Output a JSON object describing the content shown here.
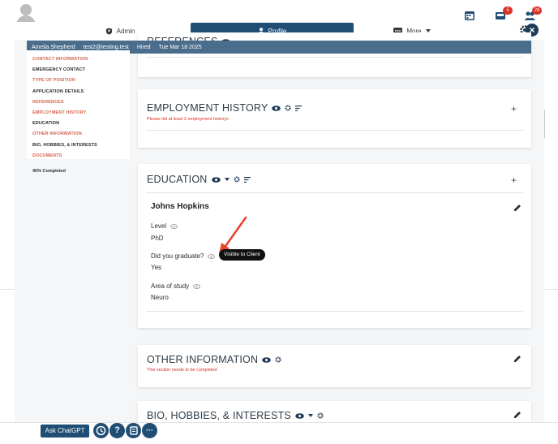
{
  "topbar": {
    "badges": {
      "inbox": "5",
      "users": "28"
    }
  },
  "tabs": {
    "admin": "Admin",
    "profile": "Profile",
    "more": "More"
  },
  "infobar": {
    "name": "Amelia Shepherd",
    "email": "test2@testing.test",
    "status": "Hired",
    "date": "Tue Mar 18 2025"
  },
  "sidebar": {
    "items": [
      {
        "label": "CONTACT INFORMATION",
        "state": "incomplete"
      },
      {
        "label": "EMERGENCY CONTACT",
        "state": "complete"
      },
      {
        "label": "TYPE OF POSITION",
        "state": "incomplete"
      },
      {
        "label": "APPLICATION DETAILS",
        "state": "complete"
      },
      {
        "label": "REFERENCES",
        "state": "incomplete"
      },
      {
        "label": "EMPLOYMENT HISTORY",
        "state": "incomplete"
      },
      {
        "label": "EDUCATION",
        "state": "complete"
      },
      {
        "label": "OTHER INFORMATION",
        "state": "incomplete"
      },
      {
        "label": "BIO, HOBBIES, & INTERESTS",
        "state": "complete"
      },
      {
        "label": "DOCUMENTS",
        "state": "incomplete"
      }
    ],
    "progress": "40% Completed"
  },
  "sections": {
    "references": {
      "title": "REFERENCES"
    },
    "employment": {
      "title": "EMPLOYMENT HISTORY",
      "warning": "Please list at least 2 employment historys"
    },
    "education": {
      "title": "EDUCATION",
      "entry_name": "Johns Hopkins",
      "fields": [
        {
          "label": "Level",
          "value": "PhD"
        },
        {
          "label": "Did you graduate?",
          "value": "Yes"
        },
        {
          "label": "Area of study",
          "value": "Neuro"
        }
      ],
      "tooltip": "Visible to Client"
    },
    "other": {
      "title": "OTHER INFORMATION",
      "warning": "This section needs to be completed"
    },
    "bio": {
      "title": "BIO, HOBBIES, & INTERESTS"
    }
  },
  "bottom_bar": {
    "ask_chatgpt": "Ask ChatGPT",
    "help_symbol": "?",
    "more_symbol": "···"
  },
  "colors": {
    "primary": "#1f4d74",
    "infobar": "#4a6d8c",
    "warning": "#d93025",
    "incomplete_nav": "#d66450",
    "arrow": "#e8452c"
  }
}
